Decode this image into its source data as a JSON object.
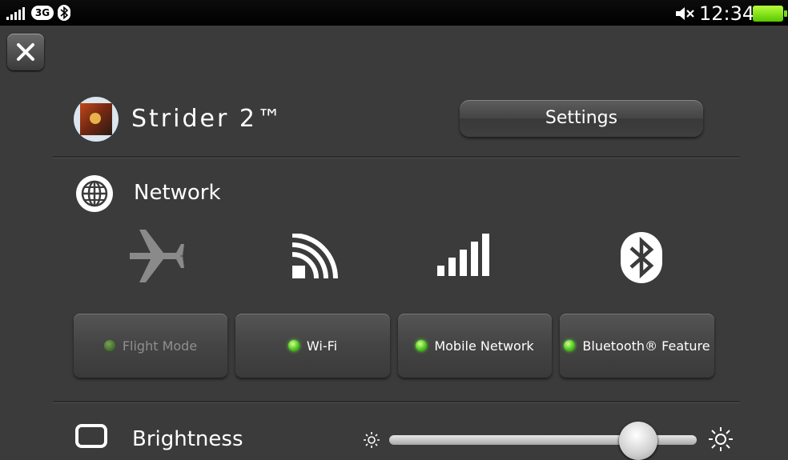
{
  "status_bar": {
    "network_type": "3G",
    "time": "12:34",
    "icons": [
      "signal-icon",
      "3g-icon",
      "bluetooth-status-icon",
      "mute-icon",
      "battery-icon"
    ],
    "battery_color": "#7ed81a"
  },
  "close_button": {
    "icon": "close-icon"
  },
  "game": {
    "title": "Strider 2™",
    "settings_label": "Settings"
  },
  "network": {
    "title": "Network",
    "icons": [
      "airplane-icon",
      "wifi-icon",
      "mobile-signal-icon",
      "bluetooth-icon"
    ],
    "toggles": [
      {
        "label": "Flight Mode",
        "state": "off"
      },
      {
        "label": "Wi-Fi",
        "state": "on"
      },
      {
        "label": "Mobile Network",
        "state": "on"
      },
      {
        "label": "Bluetooth® Feature",
        "state": "on"
      }
    ],
    "led_on_color": "#45c21b",
    "led_off_color": "#3f6b26"
  },
  "brightness": {
    "title": "Brightness",
    "level": 0.81
  }
}
